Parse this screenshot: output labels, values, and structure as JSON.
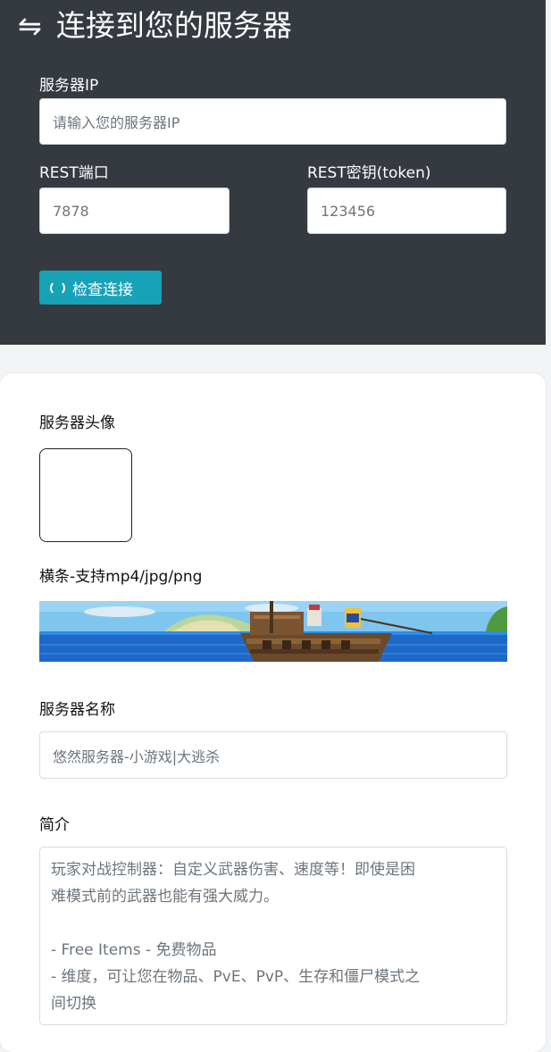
{
  "header": {
    "icon": "swap-arrows-icon",
    "title": "连接到您的服务器"
  },
  "server_ip": {
    "label": "服务器IP",
    "placeholder": "请输入您的服务器IP"
  },
  "rest_port": {
    "label": "REST端口",
    "value": "7878"
  },
  "rest_key": {
    "label": "REST密钥(token)",
    "value": "123456"
  },
  "check_button": {
    "icon": "refresh-circle-icon",
    "label": "检查连接"
  },
  "avatar": {
    "label": "服务器头像"
  },
  "banner": {
    "label": "横条-支持mp4/jpg/png"
  },
  "server_name": {
    "label": "服务器名称",
    "placeholder": "悠然服务器-小游戏|大逃杀"
  },
  "description": {
    "label": "简介",
    "lines": [
      "玩家对战控制器：自定义武器伤害、速度等！即使是困",
      "难模式前的武器也能有强大威力。",
      "",
      "- Free Items - 免费物品",
      "- 维度，可让您在物品、PvE、PvP、生存和僵尸模式之",
      "间切换"
    ]
  },
  "colors": {
    "panel": "#343a40",
    "accent": "#17a2b8",
    "card": "#ffffff"
  }
}
